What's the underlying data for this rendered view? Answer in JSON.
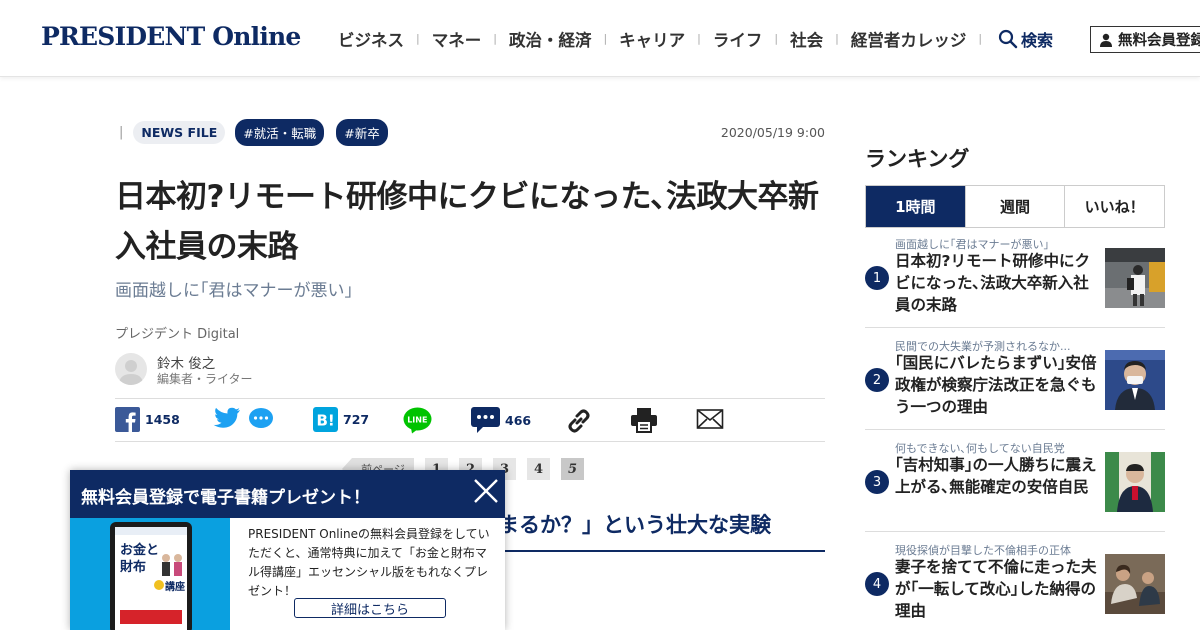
{
  "header": {
    "logo": "PRESIDENT Online",
    "nav": [
      "ビジネス",
      "マネー",
      "政治・経済",
      "キャリア",
      "ライフ",
      "社会",
      "経営者カレッジ"
    ],
    "search_label": "検索",
    "member_label": "無料会員登録"
  },
  "article": {
    "category": "NEWS FILE",
    "tags": [
      "#就活・転職",
      "#新卒"
    ],
    "date": "2020/05/19 9:00",
    "title": "日本初?リモート研修中にクビになった､法政大卒新入社員の末路",
    "subtitle": "画面越しに｢君はマナーが悪い｣",
    "publisher": "プレジデント Digital",
    "author_name": "鈴木 俊之",
    "author_role": "編集者・ライター",
    "share": {
      "facebook": "1458",
      "hatena": "727",
      "comments": "466"
    },
    "pager": {
      "prev": "前ページ",
      "pages": [
        "1",
        "2",
        "3",
        "4",
        "5"
      ],
      "current": "5"
    },
    "section_heading": "まるか？」という壮大な実験"
  },
  "ranking": {
    "title": "ランキング",
    "tabs": [
      "1時間",
      "週間",
      "いいね！"
    ],
    "active_tab": "1時間",
    "items": [
      {
        "rank": "1",
        "kicker": "画面越しに｢君はマナーが悪い｣",
        "headline": "日本初?リモート研修中にクビになった､法政大卒新入社員の末路"
      },
      {
        "rank": "2",
        "kicker": "民間での大失業が予測されるなか...",
        "headline": "｢国民にバレたらまずい｣安倍政権が検察庁法改正を急ぐもう一つの理由"
      },
      {
        "rank": "3",
        "kicker": "何もできない､何もしてない自民党",
        "headline": "｢吉村知事｣の一人勝ちに震え上がる､無能確定の安倍自民"
      },
      {
        "rank": "4",
        "kicker": "現役探偵が目撃した不倫相手の正体",
        "headline": "妻子を捨てて不倫に走った夫が｢一転して改心｣した納得の理由"
      }
    ]
  },
  "popup": {
    "title": "無料会員登録で電子書籍プレゼント！",
    "body": "PRESIDENT Onlineの無料会員登録をしていただくと、通常特典に加えて「お金と財布マル得講座」エッセンシャル版をもれなくプレゼント！",
    "button": "詳細はこちら",
    "book_title_1": "お金と",
    "book_title_2": "財布",
    "book_title_3": "講座"
  },
  "colors": {
    "brand": "#0e2a63",
    "popup_image_bg": "#0aa0e0"
  }
}
